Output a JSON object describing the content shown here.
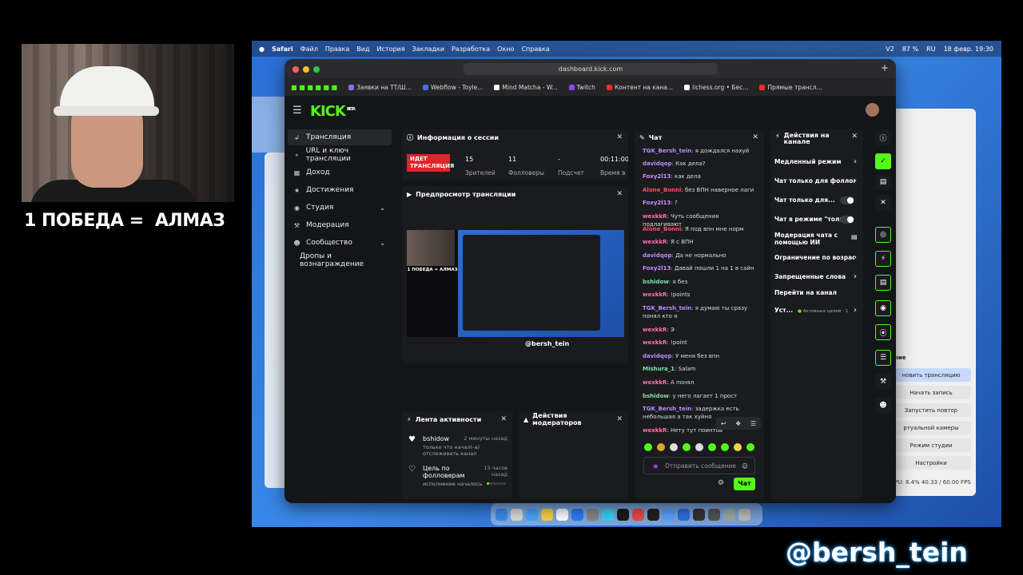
{
  "overlay": {
    "caption": "1 ПОБЕДА =  АЛМАЗ",
    "handle": "@bersh_tein"
  },
  "menubar": {
    "app": "Safari",
    "items": [
      "Файл",
      "Правка",
      "Вид",
      "История",
      "Закладки",
      "Разработка",
      "Окно",
      "Справка"
    ],
    "battery": "87 %",
    "datetime": "18 февр.  19:30",
    "lang": "RU",
    "v2": "V2"
  },
  "browser": {
    "url": "dashboard.kick.com",
    "tabs": [
      "Заявки на ТТ/Ш...",
      "Webflow - Toyle...",
      "Mind Matcha - W...",
      "Twitch",
      "Контент на кана...",
      "lichess.org • Бес...",
      "Прямые трансл..."
    ]
  },
  "kick": {
    "logo": "KICK",
    "logo_sup": "BETA",
    "sidebar": [
      {
        "label": "Трансляция",
        "icon": "broadcast-icon"
      },
      {
        "label": "URL и ключ трансляции",
        "icon": "key-icon"
      },
      {
        "label": "Доход",
        "icon": "chart-icon"
      },
      {
        "label": "Достижения",
        "icon": "trophy-icon"
      },
      {
        "label": "Студия",
        "icon": "studio-icon"
      },
      {
        "label": "Модерация",
        "icon": "wrench-icon"
      },
      {
        "label": "Сообщество",
        "icon": "people-icon"
      },
      {
        "label": "Дропы и вознаграждение",
        "icon": ""
      }
    ],
    "session": {
      "title": "Информация о сессии",
      "live": "ИДЕТ ТРАНСЛЯЦИЯ",
      "viewers": "15",
      "viewers_label": "Зрителей",
      "followers": "11",
      "followers_label": "Фолловеры",
      "subs": "-",
      "subs_label": "Подсчет",
      "time": "00:11:00",
      "time_label": "Время в"
    },
    "preview": {
      "title": "Предпросмотр трансляции",
      "caption": "1 ПОБЕДА = АЛМАЗ",
      "tag": "@bersh_tein"
    },
    "activity": {
      "title": "Лента активности",
      "items": [
        {
          "name": "bshidow",
          "time": "2 минуты назад",
          "desc": "только что начал(-а) отслеживать канал"
        },
        {
          "name": "Цель по фолловерам",
          "time": "15 часов назад",
          "desc": "исполнение началось"
        }
      ]
    },
    "mods": {
      "title": "Действия модераторов"
    },
    "chat": {
      "title": "Чат",
      "messages": [
        {
          "user": "TGK_Bersh_tein",
          "color": "#b98cff",
          "text": "я дождался нахуй"
        },
        {
          "user": "davidqop",
          "color": "#b98cff",
          "text": "Как дела?"
        },
        {
          "user": "Foxy2l13",
          "color": "#d58cff",
          "text": "как дела"
        },
        {
          "user": "Alone_Bonni",
          "color": "#ff4f6a",
          "text": "без ВПН наверное лаги"
        },
        {
          "user": "Foxy2l13",
          "color": "#d58cff",
          "text": "?"
        },
        {
          "user": "wexkkR",
          "color": "#ff6fb1",
          "text": "Чуть сообщения подлагивают"
        },
        {
          "user": "Alone_Bonni",
          "color": "#ff4f6a",
          "text": "Я под впн мне норм"
        },
        {
          "user": "wexkkR",
          "color": "#ff6fb1",
          "text": "Я с ВПН"
        },
        {
          "user": "davidqop",
          "color": "#b98cff",
          "text": "Да не нормально"
        },
        {
          "user": "Foxy2l13",
          "color": "#d58cff",
          "text": "Давай пошли 1 на 1 в сайн"
        },
        {
          "user": "bshidow",
          "color": "#7fe3a4",
          "text": "я без"
        },
        {
          "user": "wexkkR",
          "color": "#ff6fb1",
          "text": "!points"
        },
        {
          "user": "TGK_Bersh_tein",
          "color": "#b98cff",
          "text": "я думаю ты сразу понял кто я"
        },
        {
          "user": "wexkkR",
          "color": "#ff6fb1",
          "text": "Э"
        },
        {
          "user": "wexkkR",
          "color": "#ff6fb1",
          "text": "!point"
        },
        {
          "user": "davidqop",
          "color": "#b98cff",
          "text": "У меня без впн"
        },
        {
          "user": "Mishura_1",
          "color": "#7fe3a4",
          "text": "Salam"
        },
        {
          "user": "wexkkR",
          "color": "#ff6fb1",
          "text": "А понял"
        },
        {
          "user": "bshidow",
          "color": "#7fe3a4",
          "text": "у него лагает 1 прост"
        },
        {
          "user": "TGK_Bersh_tein",
          "color": "#b98cff",
          "text": "задержка есть небольшая а так хуйня"
        },
        {
          "user": "wexkkR",
          "color": "#ff6fb1",
          "text": "Нету тут поинтов"
        }
      ],
      "placeholder": "Отправить сообщение",
      "send": "Чат"
    },
    "actions": {
      "title": "Действия на канале",
      "items": [
        {
          "label": "Медленный режим",
          "kind": "chevron"
        },
        {
          "label": "Чат только для фолловеров",
          "kind": "chevron"
        },
        {
          "label": "Чат только для...",
          "kind": "toggle"
        },
        {
          "label": "Чат в режиме \"толь...",
          "kind": "toggle"
        },
        {
          "label": "Модерация чата с помощью ИИ",
          "kind": "chart"
        },
        {
          "label": "Ограничение по возрасту",
          "kind": "chevron"
        },
        {
          "label": "Запрещенные слова",
          "kind": "chevron"
        },
        {
          "label": "Перейти на канал",
          "kind": "none"
        },
        {
          "label": "Уст...",
          "kind": "chevron",
          "extra": "Активных целей - 1"
        }
      ]
    }
  },
  "obs": {
    "section": "ние",
    "buttons": [
      "новить трансляцию",
      "Начать запись",
      "Запустить повтор",
      "ртуальной камеры",
      "Режим студии",
      "Настройки"
    ],
    "status": "PU: 8.4%    40.33 / 60.00 FPS"
  }
}
